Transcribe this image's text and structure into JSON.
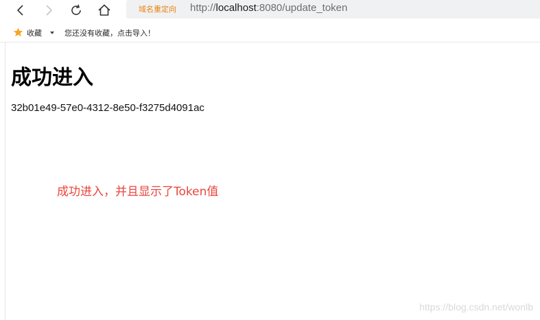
{
  "browser": {
    "redirect_tag": "域名重定向",
    "url_prefix": "http://",
    "url_host": "localhost",
    "url_rest": ":8080/update_token"
  },
  "bookmarks": {
    "label": "收藏",
    "empty_message": "您还没有收藏，点击导入！"
  },
  "page": {
    "heading": "成功进入",
    "token": "32b01e49-57e0-4312-8e50-f3275d4091ac"
  },
  "annotation": {
    "text": "成功进入，并且显示了Token值",
    "color": "#e8453c"
  },
  "watermark": {
    "text": "https://blog.csdn.net/wonlb"
  },
  "icons": {
    "back": "back-arrow-icon",
    "forward": "forward-arrow-icon",
    "reload": "reload-icon",
    "home": "home-icon",
    "bookmark_star": "star-icon",
    "bookmark_dropdown": "caret-down-icon"
  }
}
